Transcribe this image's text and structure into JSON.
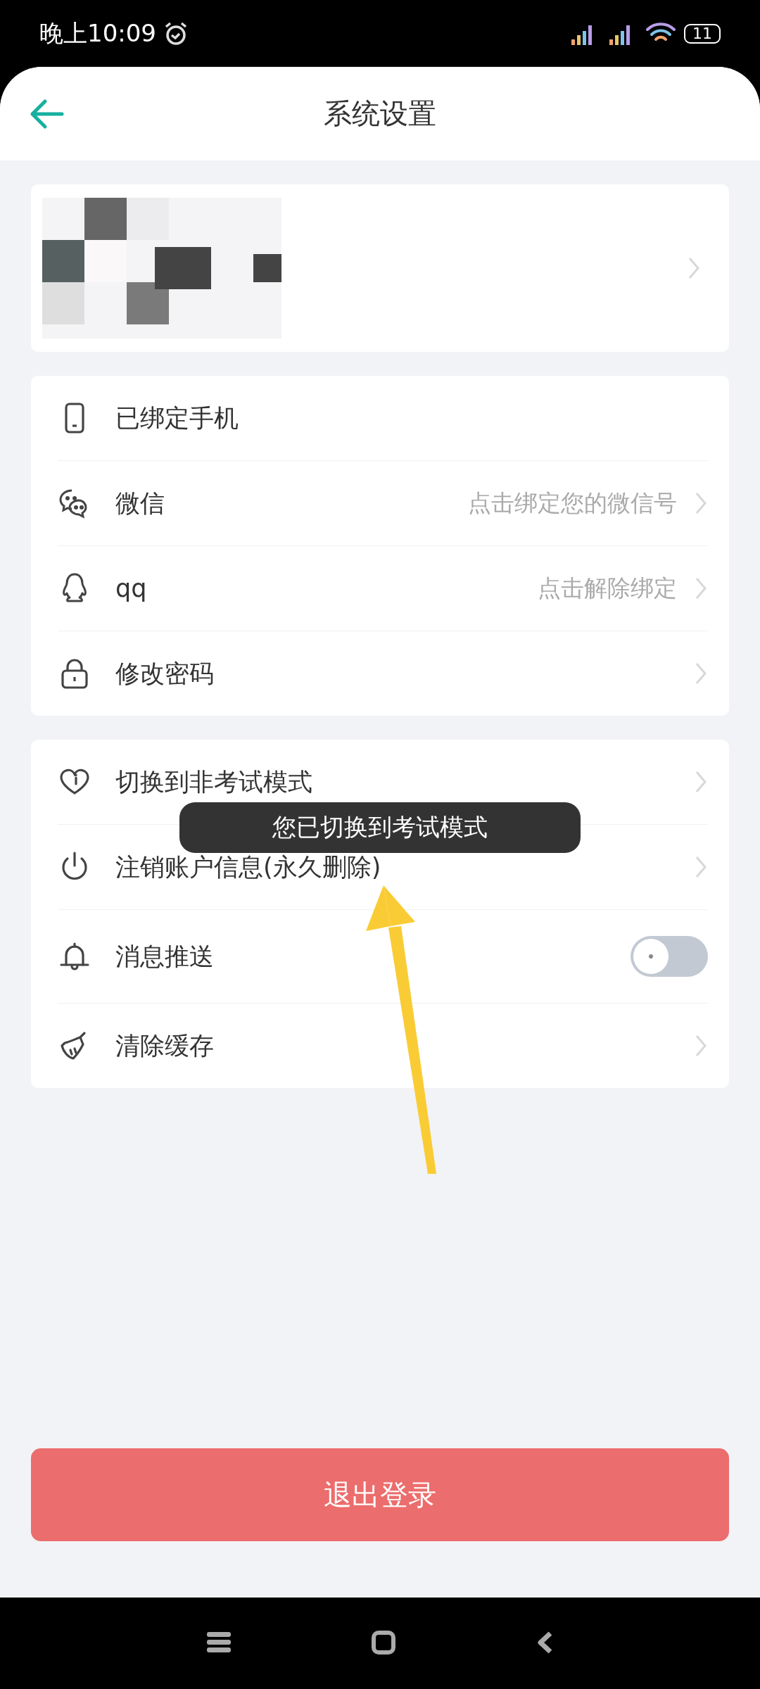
{
  "status_bar": {
    "time": "晚上10:09",
    "battery": "11"
  },
  "header": {
    "title": "系统设置"
  },
  "account_items": [
    {
      "kind": "plain",
      "label": "已绑定手机"
    },
    {
      "kind": "link",
      "label": "微信",
      "value": "点击绑定您的微信号"
    },
    {
      "kind": "link",
      "label": "qq",
      "value": "点击解除绑定"
    },
    {
      "kind": "link",
      "label": "修改密码"
    }
  ],
  "settings_items": [
    {
      "kind": "link",
      "label": "切换到非考试模式"
    },
    {
      "kind": "link",
      "label": "注销账户信息(永久删除)"
    },
    {
      "kind": "switch",
      "label": "消息推送",
      "on": false
    },
    {
      "kind": "link",
      "label": "清除缓存"
    }
  ],
  "toast": "您已切换到考试模式",
  "logout_button": "退出登录"
}
